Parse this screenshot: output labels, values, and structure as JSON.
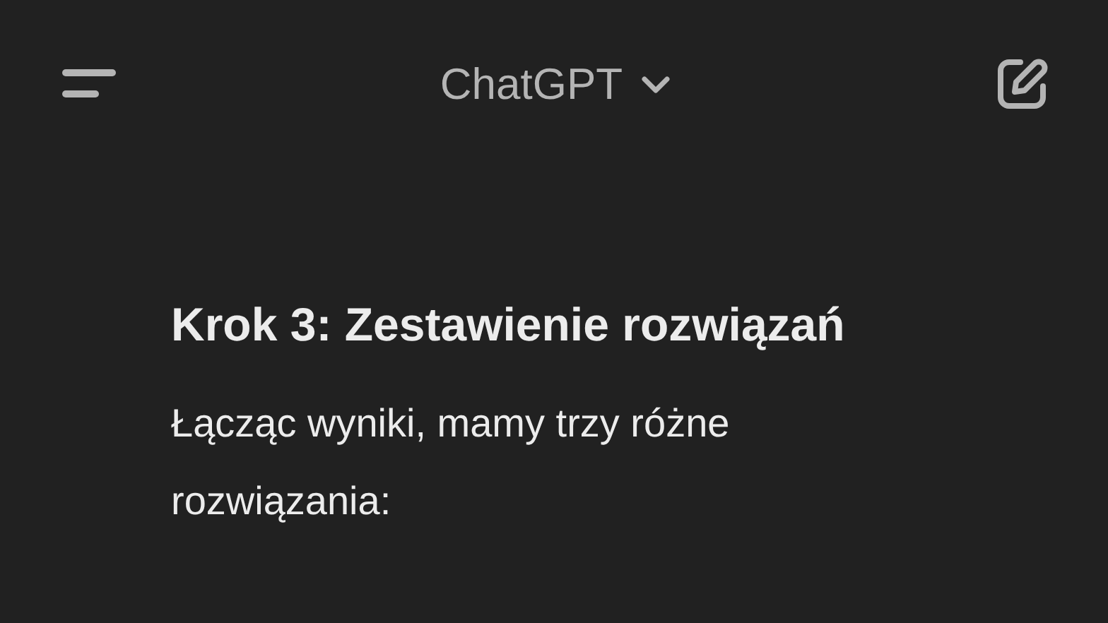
{
  "header": {
    "title": "ChatGPT"
  },
  "message": {
    "heading": "Krok 3: Zestawienie rozwiązań",
    "paragraph": "Łącząc wyniki, mamy trzy różne rozwiązania:"
  }
}
